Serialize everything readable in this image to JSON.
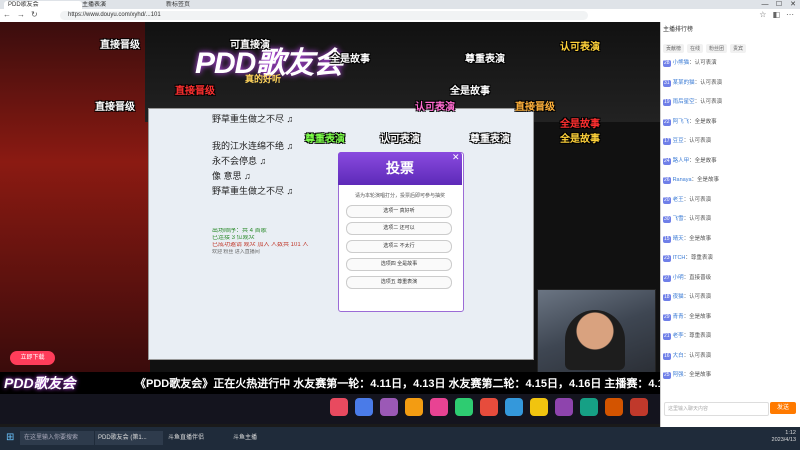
{
  "browser": {
    "tabs": [
      "PDD歌友会",
      "主播表演",
      "新标签页"
    ],
    "url": "https://www.douyu.com/xyhd/...101",
    "window_controls": [
      "—",
      "☐",
      "✕"
    ]
  },
  "stream": {
    "logo": "PDD歌友会",
    "logo_sub": "真的好听",
    "chat_lines": [
      "野草重生做之不尽 ♫",
      "我的江水连绵不绝 ♫",
      "永不会停息 ♫",
      "像 意思 ♫",
      "野草重生做之不尽 ♫"
    ],
    "chat_system": [
      "出场顺序：共 4 首歌",
      "已连接 3 位观众",
      "已成功邀请 观众 加入 人数共 101 人",
      "欢迎 粉丝 进入直播间"
    ],
    "vote": {
      "title": "投票",
      "question": "请为本轮演唱打分，投票后即可参与抽奖",
      "options": [
        "选项一 真好听",
        "选项二 还可以",
        "选项三 不太行",
        "选项四 全是故事",
        "选项五 尊重表演"
      ]
    },
    "ticker": "《PDD歌友会》正在火热进行中  水友赛第一轮：4.11日，4.13日  水友赛第二轮：4.15日，4.16日 主播赛：4.12日",
    "send_btn": "立即下载",
    "danmaku": [
      {
        "t": "直接晋级",
        "c": "w"
      },
      {
        "t": "可直接演",
        "c": "w"
      },
      {
        "t": "全是故事",
        "c": "w"
      },
      {
        "t": "尊重表演",
        "c": "w"
      },
      {
        "t": "认可表演",
        "c": "y"
      },
      {
        "t": "直接晋级",
        "c": "r"
      },
      {
        "t": "全是故事",
        "c": "r"
      },
      {
        "t": "认可表演",
        "c": "p"
      },
      {
        "t": "尊重表演",
        "c": "g"
      },
      {
        "t": "直接晋级",
        "c": "w"
      },
      {
        "t": "全是故事",
        "c": "w"
      },
      {
        "t": "认可表演",
        "c": "w"
      },
      {
        "t": "直接晋级",
        "c": "o"
      },
      {
        "t": "尊重表演",
        "c": "w"
      },
      {
        "t": "全是故事",
        "c": "y"
      }
    ]
  },
  "rpanel": {
    "title": "主播排行榜",
    "tabs": [
      "贡献榜",
      "在线",
      "粉丝团",
      "贵宾"
    ],
    "rows": [
      {
        "lvl": "28",
        "nm": "小熊猫",
        "txt": "认可表演"
      },
      {
        "lvl": "31",
        "nm": "某某的猫",
        "txt": "认可表演"
      },
      {
        "lvl": "19",
        "nm": "雨后星空",
        "txt": "认可表演"
      },
      {
        "lvl": "22",
        "nm": "阿飞飞",
        "txt": "全是故事"
      },
      {
        "lvl": "17",
        "nm": "豆豆",
        "txt": "认可表演"
      },
      {
        "lvl": "24",
        "nm": "路人甲",
        "txt": "全是故事"
      },
      {
        "lvl": "26",
        "nm": "Ranaya",
        "txt": "全是故事"
      },
      {
        "lvl": "20",
        "nm": "老王",
        "txt": "认可表演"
      },
      {
        "lvl": "30",
        "nm": "飞雪",
        "txt": "认可表演"
      },
      {
        "lvl": "15",
        "nm": "晴天",
        "txt": "全是故事"
      },
      {
        "lvl": "23",
        "nm": "ITCH",
        "txt": "尊重表演"
      },
      {
        "lvl": "27",
        "nm": "小明",
        "txt": "直接晋级"
      },
      {
        "lvl": "18",
        "nm": "夜猫",
        "txt": "认可表演"
      },
      {
        "lvl": "29",
        "nm": "青青",
        "txt": "全是故事"
      },
      {
        "lvl": "21",
        "nm": "老李",
        "txt": "尊重表演"
      },
      {
        "lvl": "16",
        "nm": "大白",
        "txt": "认可表演"
      },
      {
        "lvl": "25",
        "nm": "阿强",
        "txt": "全是故事"
      }
    ],
    "input_placeholder": "这里输入聊天内容",
    "send": "发送"
  },
  "taskbar": {
    "search": "在这里输入你要搜索",
    "items": [
      "PDD歌友会 (第1...",
      "斗鱼直播伴侣",
      "斗鱼主播"
    ],
    "time": "1:12",
    "date": "2023/4/13"
  }
}
